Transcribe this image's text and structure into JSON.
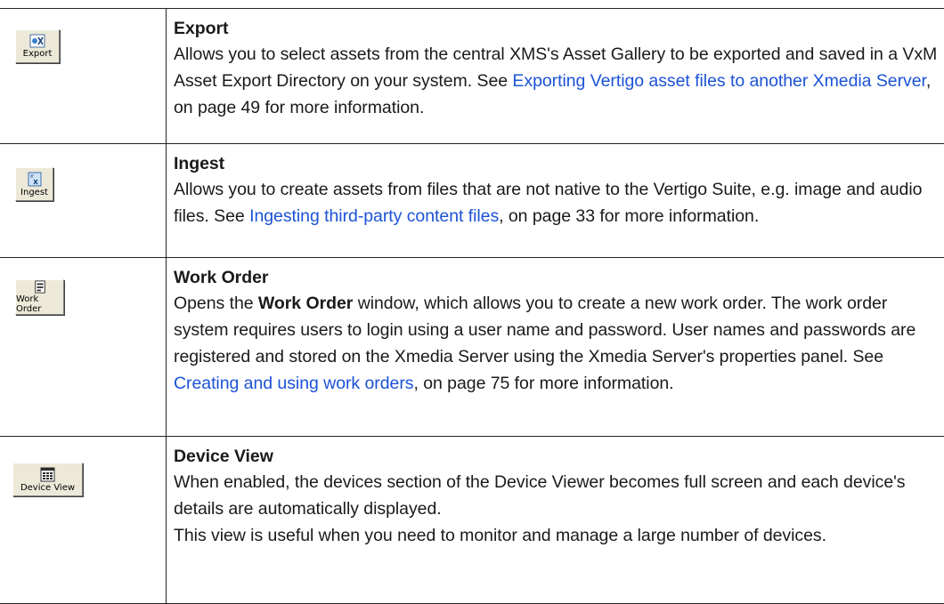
{
  "rows": [
    {
      "button_label": "Export",
      "icon": "export-icon",
      "title": "Export",
      "paragraphs": [
        {
          "before": "Allows you to select assets from the central XMS's Asset Gallery to be exported and saved in a VxM Asset Export Directory on your system. See ",
          "link": "Exporting Vertigo asset files to another Xmedia Server",
          "after": ", on page 49 for more information."
        }
      ]
    },
    {
      "button_label": "Ingest",
      "icon": "ingest-icon",
      "title": "Ingest",
      "paragraphs": [
        {
          "before": "Allows you to create assets from files that are not native to the Vertigo Suite, e.g. image and audio files. See ",
          "link": "Ingesting third-party content files",
          "after": ", on page 33 for more information."
        }
      ]
    },
    {
      "button_label": "Work Order",
      "icon": "work-order-icon",
      "title": "Work Order",
      "paragraphs": [
        {
          "pre": "Opens the ",
          "bold": "Work Order",
          "before": " window, which allows you to create a new work order. The work order system requires users to login using a user name and password. User names and passwords are registered and stored on the Xmedia Server using the Xmedia Server's properties panel. See ",
          "link": "Creating and using work orders",
          "after": ", on page 75 for more information."
        }
      ]
    },
    {
      "button_label": "Device View",
      "icon": "device-view-icon",
      "title": "Device View",
      "paragraphs": [
        {
          "before": "When enabled, the devices section of the Device Viewer becomes full screen and each device's details are automatically displayed."
        },
        {
          "before": "This view is useful when you need to monitor and manage a large number of devices."
        }
      ]
    }
  ],
  "colors": {
    "link": "#1b52d6",
    "button_face": "#ece9d8",
    "rule": "#222222"
  }
}
